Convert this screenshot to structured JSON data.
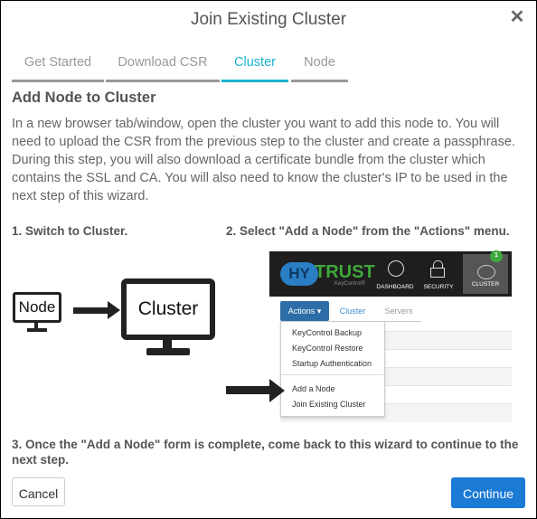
{
  "dialog": {
    "title": "Join Existing Cluster",
    "close_icon": "close-icon"
  },
  "tabs": [
    {
      "label": "Get Started",
      "active": false
    },
    {
      "label": "Download CSR",
      "active": false
    },
    {
      "label": "Cluster",
      "active": true
    },
    {
      "label": "Node",
      "active": false
    }
  ],
  "content": {
    "heading": "Add Node to Cluster",
    "paragraph": "In a new browser tab/window, open the cluster you want to add this node to. You will need to upload the CSR from the previous step to the cluster and create a passphrase. During this step, you will also download a certificate bundle from the cluster which contains the SSL and CA. You will also need to know the cluster's IP to be used in the next step of this wizard.",
    "step1": "1. Switch to Cluster.",
    "step2": "2. Select \"Add a Node\" from the \"Actions\" menu.",
    "step3": "3. Once the \"Add a Node\" form is complete, come back to this wizard to continue to the next step."
  },
  "diagram": {
    "node_label": "Node",
    "cluster_label": "Cluster"
  },
  "keycontrol": {
    "logo_hy": "HY",
    "logo_trust": "TRUST",
    "logo_sub": "KeyControl®",
    "nav": [
      {
        "label": "DASHBOARD",
        "icon": "dashboard-gauge-icon"
      },
      {
        "label": "SECURITY",
        "icon": "lock-icon"
      },
      {
        "label": "CLUSTER",
        "icon": "cluster-icon",
        "badge": "1",
        "active": true
      }
    ],
    "actions_label": "Actions ▾",
    "tabs": [
      "Cluster",
      "Servers"
    ],
    "menu": [
      "KeyControl Backup",
      "KeyControl Restore",
      "Startup Authentication",
      "Add a Node",
      "Join Existing Cluster"
    ]
  },
  "footer": {
    "cancel_label": "Cancel",
    "continue_label": "Continue"
  },
  "colors": {
    "accent": "#1ab3cf",
    "primary_button": "#1a7ad4",
    "brand_green": "#3ea83c",
    "brand_blue": "#2a7ec4"
  }
}
